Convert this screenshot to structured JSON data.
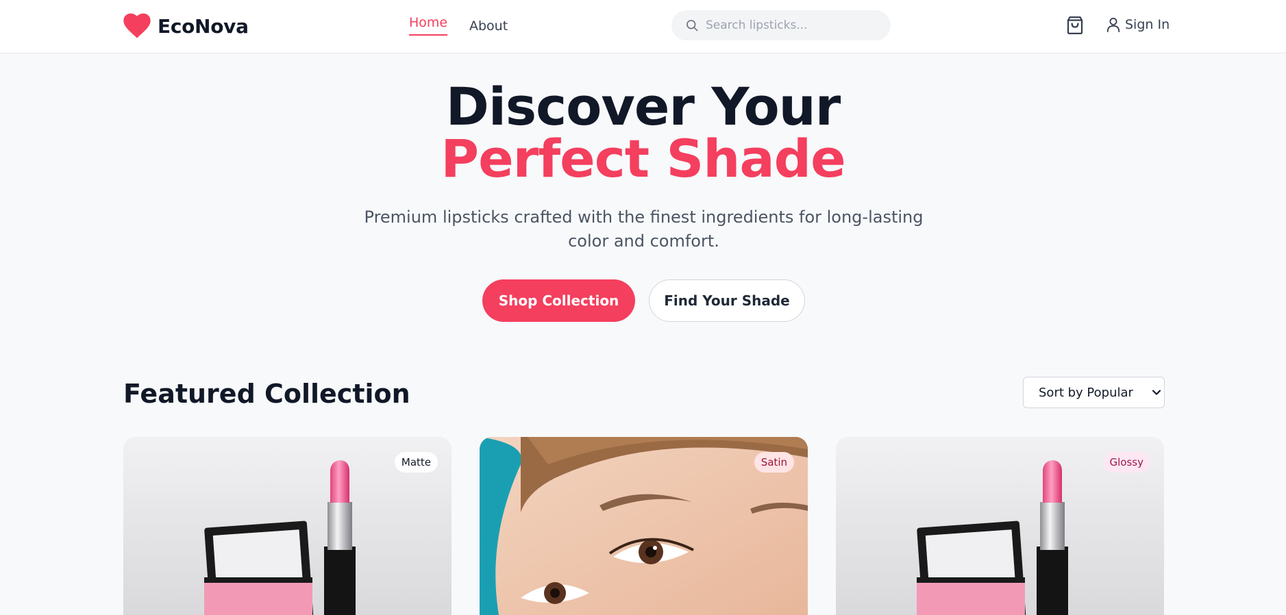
{
  "header": {
    "brand": "EcoNova",
    "nav": [
      {
        "label": "Home",
        "active": true
      },
      {
        "label": "About",
        "active": false
      }
    ],
    "search_placeholder": "Search lipsticks...",
    "signin_label": "Sign In",
    "icons": [
      "heart-logo-icon",
      "search-icon",
      "shopping-bag-icon",
      "user-icon"
    ]
  },
  "hero": {
    "title_line1": "Discover Your",
    "title_line2": "Perfect Shade",
    "subtitle": "Premium lipsticks crafted with the finest ingredients for long-lasting color and comfort.",
    "primary_button": "Shop Collection",
    "secondary_button": "Find Your Shade"
  },
  "featured": {
    "title": "Featured Collection",
    "sort_selected": "Sort by Popular",
    "products": [
      {
        "badge": "Matte",
        "image": "lipstick-with-compact"
      },
      {
        "badge": "Satin",
        "image": "model-face-closeup"
      },
      {
        "badge": "Glossy",
        "image": "lipstick-with-compact"
      }
    ]
  },
  "colors": {
    "accent": "#f43f5e",
    "text_dark": "#111827",
    "text_muted": "#4b5563",
    "background": "#f8f9fb"
  }
}
